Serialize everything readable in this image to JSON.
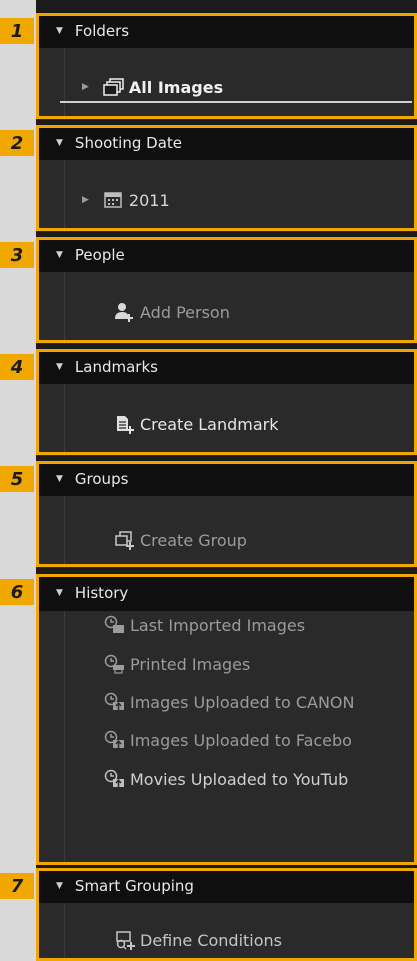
{
  "callouts": [
    "1",
    "2",
    "3",
    "4",
    "5",
    "6",
    "7"
  ],
  "sections": {
    "folders": {
      "title": "Folders",
      "items": [
        {
          "label": "All Images"
        }
      ]
    },
    "shooting_date": {
      "title": "Shooting Date",
      "items": [
        {
          "label": "2011"
        }
      ]
    },
    "people": {
      "title": "People",
      "items": [
        {
          "label": "Add Person"
        }
      ]
    },
    "landmarks": {
      "title": "Landmarks",
      "items": [
        {
          "label": "Create Landmark"
        }
      ]
    },
    "groups": {
      "title": "Groups",
      "items": [
        {
          "label": "Create Group"
        }
      ]
    },
    "history": {
      "title": "History",
      "items": [
        {
          "label": "Last Imported Images"
        },
        {
          "label": "Printed Images"
        },
        {
          "label": "Images Uploaded to CANON"
        },
        {
          "label": "Images Uploaded to Facebo"
        },
        {
          "label": "Movies Uploaded to YouTub"
        }
      ]
    },
    "smart_grouping": {
      "title": "Smart Grouping",
      "items": [
        {
          "label": "Define Conditions"
        }
      ]
    }
  },
  "colors": {
    "highlight": "#f0a800",
    "panel_bg": "#1b1b1b",
    "header_bg": "#0f0f0f"
  }
}
